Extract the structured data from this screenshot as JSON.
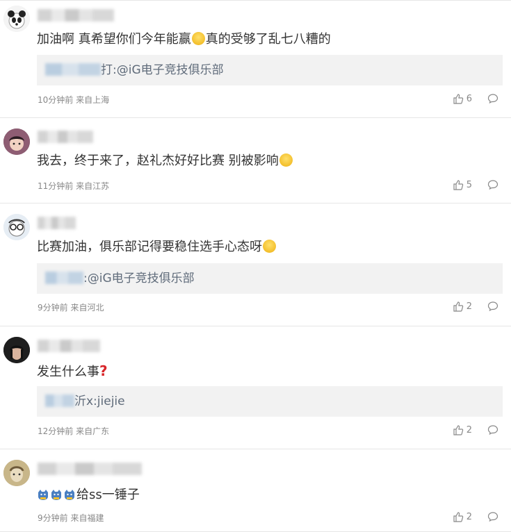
{
  "comments": [
    {
      "text": [
        "加油啊 真希望你们今年能赢",
        "真的受够了乱七八糟的"
      ],
      "quote": "打:@iG电子竞技俱乐部",
      "meta": "10分钟前 来自上海",
      "likes": "6",
      "emoji": "crying-face-emoji"
    },
    {
      "text": [
        "我去，终于来了，赵礼杰好好比赛 别被影响",
        ""
      ],
      "meta": "11分钟前 来自江苏",
      "likes": "5",
      "emoji": "crying-face-emoji"
    },
    {
      "text": [
        "比赛加油，俱乐部记得要稳住选手心态呀",
        ""
      ],
      "quote": ":@iG电子竞技俱乐部",
      "meta": "9分钟前 来自河北",
      "likes": "2",
      "emoji": "smile-emoji"
    },
    {
      "text": [
        "发生什么事",
        ""
      ],
      "quote": "沂x:jiejie",
      "meta": "12分钟前 来自广东",
      "likes": "2",
      "emoji": "question-mark-emoji"
    },
    {
      "text": [
        "给ss一锤子",
        ""
      ],
      "meta": "9分钟前 来自福建",
      "likes": "2",
      "emoji": "cat-emoji"
    }
  ]
}
